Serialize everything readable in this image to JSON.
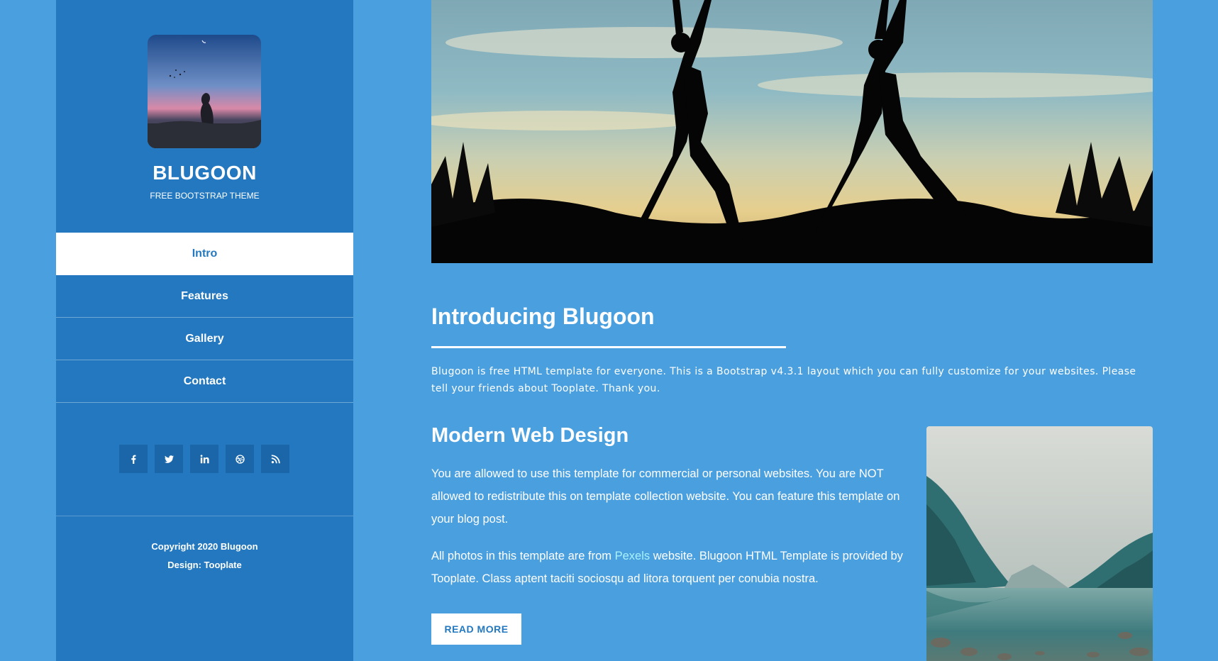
{
  "sidebar": {
    "brand_title": "BLUGOON",
    "brand_subtitle": "FREE BOOTSTRAP THEME",
    "nav": [
      {
        "label": "Intro",
        "active": true
      },
      {
        "label": "Features",
        "active": false
      },
      {
        "label": "Gallery",
        "active": false
      },
      {
        "label": "Contact",
        "active": false
      }
    ],
    "social_icons": [
      "facebook-icon",
      "twitter-icon",
      "linkedin-icon",
      "dribbble-icon",
      "rss-icon"
    ],
    "copyright": "Copyright 2020 Blugoon",
    "design_credit": "Design: Tooplate"
  },
  "main": {
    "intro_title": "Introducing Blugoon",
    "intro_text": "Blugoon is free HTML template for everyone. This is a Bootstrap v4.3.1 layout which you can fully customize for your websites. Please tell your friends about Tooplate. Thank you.",
    "section_title": "Modern Web Design",
    "para1": "You are allowed to use this template for commercial or personal websites. You are NOT allowed to redistribute this on template collection website. You can feature this template on your blog post.",
    "para2_before": "All photos in this template are from ",
    "para2_link": "Pexels",
    "para2_after": " website. Blugoon HTML Template is provided by Tooplate. Class aptent taciti sociosqu ad litora torquent per conubia nostra.",
    "button_label": "READ MORE"
  },
  "colors": {
    "page_bg": "#4a9fdf",
    "sidebar_bg": "#2378bf",
    "accent_link": "#a8f3ff"
  }
}
